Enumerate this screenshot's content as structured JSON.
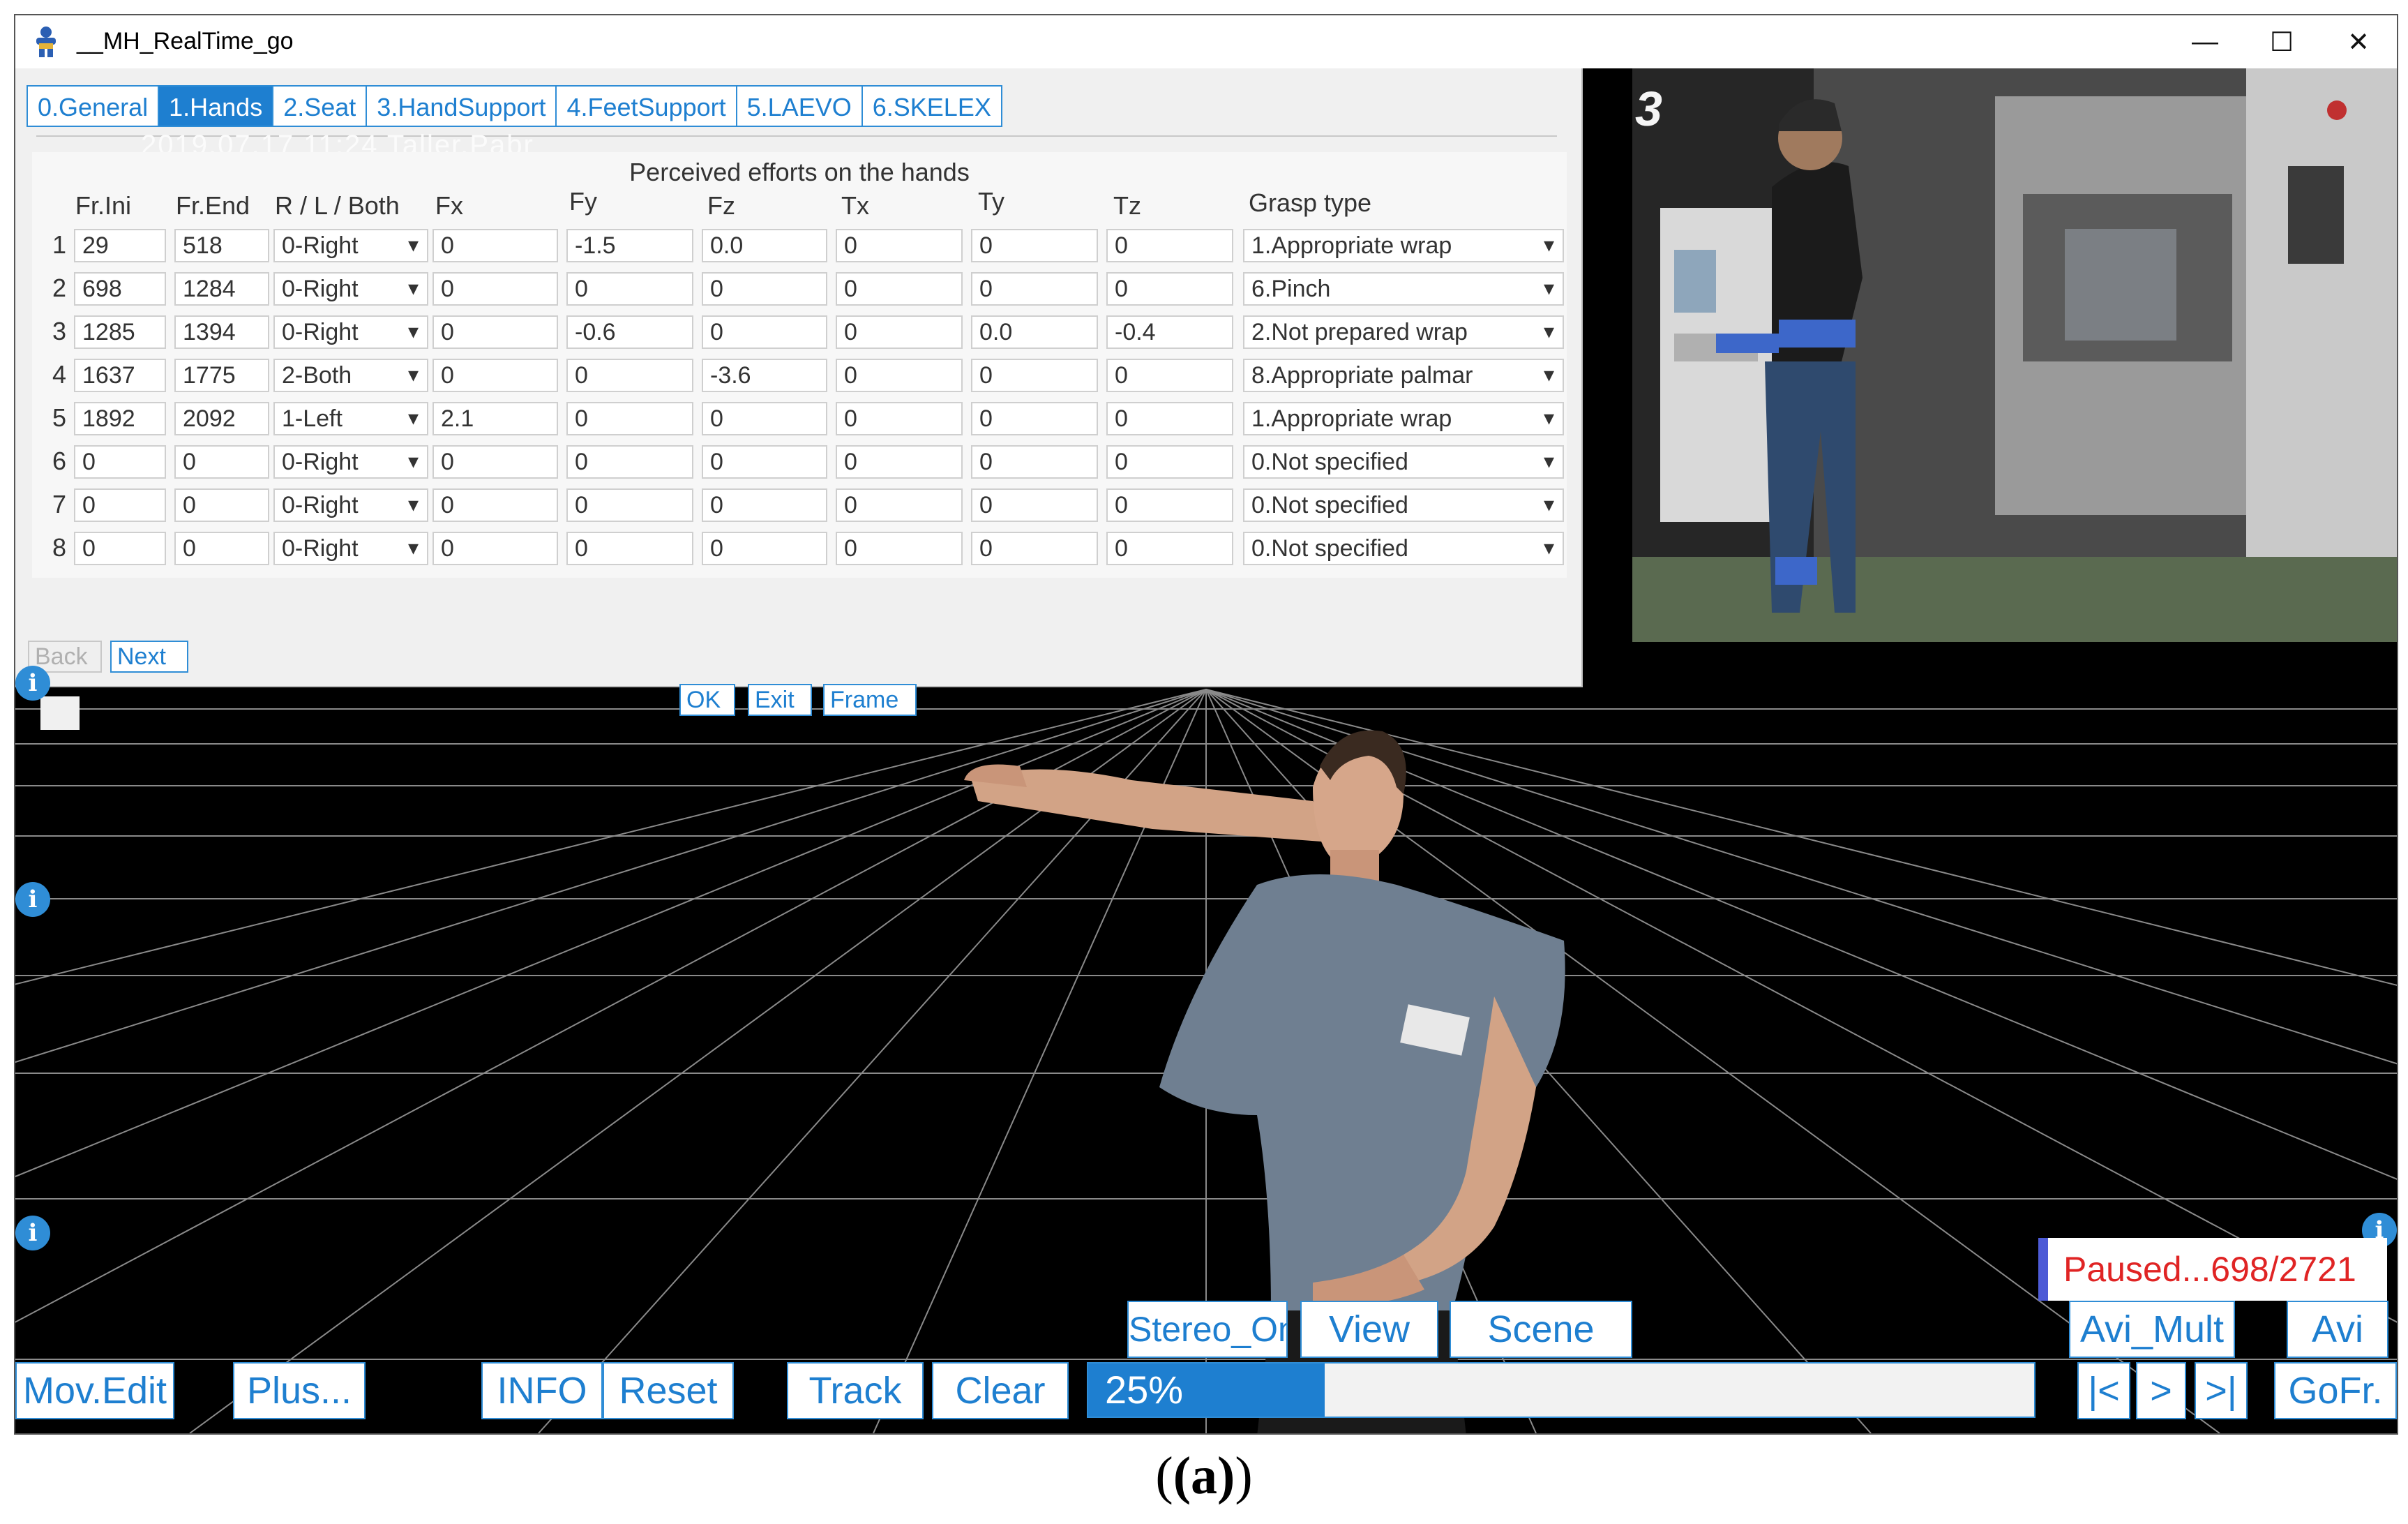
{
  "window": {
    "title": "__MH_RealTime_go",
    "controls": [
      "minimize",
      "maximize",
      "close"
    ]
  },
  "dialog": {
    "tabs": [
      {
        "label": "0.General",
        "active": false
      },
      {
        "label": "1.Hands",
        "active": true
      },
      {
        "label": "2.Seat",
        "active": false
      },
      {
        "label": "3.HandSupport",
        "active": false
      },
      {
        "label": "4.FeetSupport",
        "active": false
      },
      {
        "label": "5.LAEVO",
        "active": false
      },
      {
        "label": "6.SKELEX",
        "active": false
      }
    ],
    "background_text": "2019.07.17   11:24  Taller.Pabr",
    "section_title": "Perceived efforts on the hands",
    "columns": [
      "Fr.Ini",
      "Fr.End",
      "R / L / Both",
      "Fx",
      "Fy",
      "Fz",
      "Tx",
      "Ty",
      "Tz",
      "Grasp type"
    ],
    "rows": [
      {
        "n": "1",
        "ini": "29",
        "end": "518",
        "side": "0-Right",
        "fx": "0",
        "fy": "-1.5",
        "fz": "0.0",
        "tx": "0",
        "ty": "0",
        "tz": "0",
        "grasp": "1.Appropriate wrap"
      },
      {
        "n": "2",
        "ini": "698",
        "end": "1284",
        "side": "0-Right",
        "fx": "0",
        "fy": "0",
        "fz": "0",
        "tx": "0",
        "ty": "0",
        "tz": "0",
        "grasp": "6.Pinch"
      },
      {
        "n": "3",
        "ini": "1285",
        "end": "1394",
        "side": "0-Right",
        "fx": "0",
        "fy": "-0.6",
        "fz": "0",
        "tx": "0",
        "ty": "0.0",
        "tz": "-0.4",
        "grasp": "2.Not prepared wrap"
      },
      {
        "n": "4",
        "ini": "1637",
        "end": "1775",
        "side": "2-Both",
        "fx": "0",
        "fy": "0",
        "fz": "-3.6",
        "tx": "0",
        "ty": "0",
        "tz": "0",
        "grasp": "8.Appropriate palmar"
      },
      {
        "n": "5",
        "ini": "1892",
        "end": "2092",
        "side": "1-Left",
        "fx": "2.1",
        "fy": "0",
        "fz": "0",
        "tx": "0",
        "ty": "0",
        "tz": "0",
        "grasp": "1.Appropriate wrap"
      },
      {
        "n": "6",
        "ini": "0",
        "end": "0",
        "side": "0-Right",
        "fx": "0",
        "fy": "0",
        "fz": "0",
        "tx": "0",
        "ty": "0",
        "tz": "0",
        "grasp": "0.Not specified"
      },
      {
        "n": "7",
        "ini": "0",
        "end": "0",
        "side": "0-Right",
        "fx": "0",
        "fy": "0",
        "fz": "0",
        "tx": "0",
        "ty": "0",
        "tz": "0",
        "grasp": "0.Not specified"
      },
      {
        "n": "8",
        "ini": "0",
        "end": "0",
        "side": "0-Right",
        "fx": "0",
        "fy": "0",
        "fz": "0",
        "tx": "0",
        "ty": "0",
        "tz": "0",
        "grasp": "0.Not specified"
      }
    ],
    "nav": {
      "back": "Back",
      "next": "Next"
    },
    "actions": {
      "ok": "OK",
      "exit": "Exit",
      "frame": "Frame"
    }
  },
  "video": {
    "marker": "3",
    "description_icon": "camera-feed"
  },
  "stage": {
    "status": "Paused...698/2721",
    "progress_label": "25%",
    "progress": 0.25,
    "row1_buttons": {
      "stereo": "Stereo_On",
      "view": "View",
      "scene": "Scene",
      "avi_mult": "Avi_Mult",
      "avi": "Avi"
    },
    "row2_buttons": {
      "mov_edit": "Mov.Edit",
      "plus": "Plus...",
      "info": "INFO",
      "reset": "Reset",
      "track": "Track",
      "clear": "Clear",
      "first": "|<",
      "play": ">",
      "last": ">|",
      "gofr": "GoFr."
    }
  },
  "colors": {
    "accent": "#1e7fd0",
    "status_text": "#e02424",
    "status_bar": "#4d5bd6",
    "background": "#000000"
  },
  "caption": "(a)"
}
